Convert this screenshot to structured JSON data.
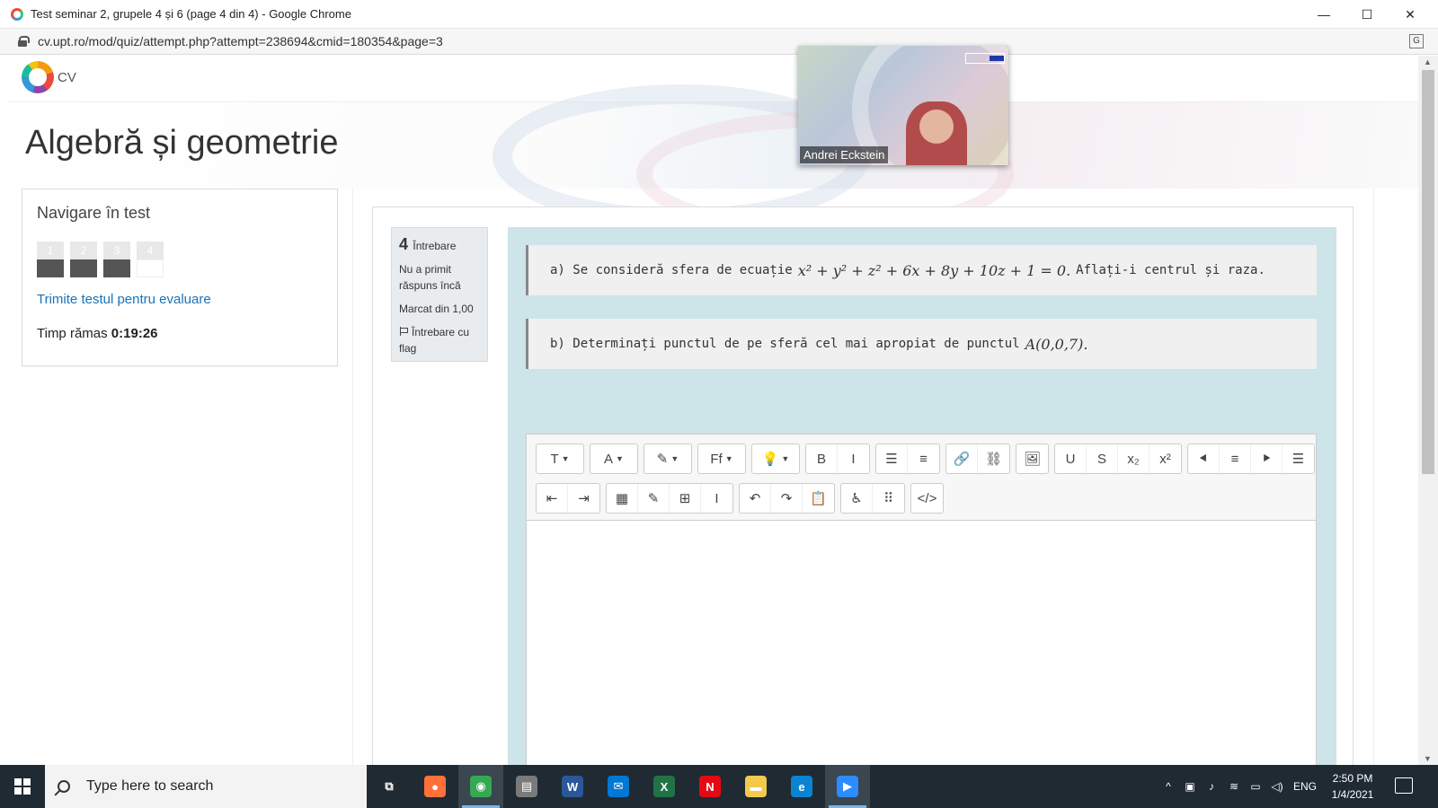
{
  "window": {
    "title": "Test seminar 2, grupele 4 și 6 (page 4 din 4) - Google Chrome",
    "url": "cv.upt.ro/mod/quiz/attempt.php?attempt=238694&cmid=180354&page=3",
    "controls": {
      "minimize": "—",
      "maximize": "☐",
      "close": "✕"
    }
  },
  "site": {
    "logo_text": "CV",
    "course_title": "Algebră și geometrie"
  },
  "quiz_nav": {
    "title": "Navigare în test",
    "questions": [
      {
        "num": "1",
        "state": "answered"
      },
      {
        "num": "2",
        "state": "answered"
      },
      {
        "num": "3",
        "state": "answered"
      },
      {
        "num": "4",
        "state": "current"
      }
    ],
    "finish_link": "Trimite testul pentru evaluare",
    "timer_label": "Timp rămas",
    "timer_value": "0:19:26"
  },
  "question": {
    "number": "4",
    "label": "Întrebare",
    "status": "Nu a primit răspuns încă",
    "mark": "Marcat din 1,00",
    "flag": "Întrebare cu flag",
    "part_a_prefix": "a) Se consideră sfera de ecuație",
    "part_a_math": "x² + y² + z² + 6x + 8y + 10z + 1 = 0.",
    "part_a_suffix": "Aflați-i centrul și raza.",
    "part_b_prefix": "b) Determinați punctul de pe sferă cel mai apropiat de punctul",
    "part_b_math": "A(0,0,7)."
  },
  "editor": {
    "row1": [
      {
        "name": "paragraph-style-button",
        "glyph": "T",
        "caret": true,
        "wide": true
      },
      {
        "name": "font-color-button",
        "glyph": "A",
        "caret": true,
        "wide": true
      },
      {
        "name": "background-color-button",
        "glyph": "✎",
        "caret": true,
        "wide": true
      },
      {
        "name": "font-family-button",
        "glyph": "Ff",
        "caret": true,
        "wide": true
      },
      {
        "name": "styles-button",
        "glyph": "💡",
        "caret": true,
        "wide": true
      },
      {
        "name": "bold-button",
        "glyph": "B"
      },
      {
        "name": "italic-button",
        "glyph": "I"
      },
      {
        "name": "bullet-list-button",
        "glyph": "☰"
      },
      {
        "name": "numbered-list-button",
        "glyph": "≡"
      },
      {
        "name": "link-button",
        "glyph": "🔗"
      },
      {
        "name": "unlink-button",
        "glyph": "⛓"
      },
      {
        "name": "image-button",
        "glyph": "🖼"
      },
      {
        "name": "underline-button",
        "glyph": "U"
      },
      {
        "name": "strikethrough-button",
        "glyph": "S"
      },
      {
        "name": "subscript-button",
        "glyph": "x₂"
      },
      {
        "name": "superscript-button",
        "glyph": "x²"
      },
      {
        "name": "align-left-button",
        "glyph": "⯇"
      },
      {
        "name": "align-center-button",
        "glyph": "≡"
      },
      {
        "name": "align-right-button",
        "glyph": "⯈"
      },
      {
        "name": "justify-button",
        "glyph": "☰"
      }
    ],
    "row2": [
      {
        "name": "outdent-button",
        "glyph": "⇤"
      },
      {
        "name": "indent-button",
        "glyph": "⇥"
      },
      {
        "name": "equation-button",
        "glyph": "▦"
      },
      {
        "name": "edit-button",
        "glyph": "✎"
      },
      {
        "name": "table-button",
        "glyph": "⊞"
      },
      {
        "name": "special-char-button",
        "glyph": "I"
      },
      {
        "name": "undo-button",
        "glyph": "↶"
      },
      {
        "name": "redo-button",
        "glyph": "↷"
      },
      {
        "name": "paste-button",
        "glyph": "📋"
      },
      {
        "name": "accessibility-button",
        "glyph": "♿"
      },
      {
        "name": "screenreader-button",
        "glyph": "⠿"
      },
      {
        "name": "html-button",
        "glyph": "</>"
      }
    ]
  },
  "video": {
    "participant": "Andrei Eckstein"
  },
  "taskbar": {
    "search_placeholder": "Type here to search",
    "apps": [
      {
        "name": "task-view-icon",
        "glyph": "⧉",
        "color": "transparent"
      },
      {
        "name": "firefox-icon",
        "glyph": "●",
        "color": "#ff7139"
      },
      {
        "name": "chrome-icon",
        "glyph": "◉",
        "color": "#34a853",
        "active": true
      },
      {
        "name": "store-icon",
        "glyph": "▤",
        "color": "#7a7a7a"
      },
      {
        "name": "word-icon",
        "glyph": "W",
        "color": "#2b579a"
      },
      {
        "name": "mail-icon",
        "glyph": "✉",
        "color": "#0078d4"
      },
      {
        "name": "excel-icon",
        "glyph": "X",
        "color": "#217346"
      },
      {
        "name": "netflix-icon",
        "glyph": "N",
        "color": "#e50914"
      },
      {
        "name": "file-explorer-icon",
        "glyph": "▬",
        "color": "#f2c94c"
      },
      {
        "name": "edge-icon",
        "glyph": "e",
        "color": "#0a84d0"
      },
      {
        "name": "zoom-icon",
        "glyph": "▶",
        "color": "#2d8cff",
        "active": true
      }
    ],
    "language": "ENG",
    "time": "2:50 PM",
    "date": "1/4/2021"
  }
}
